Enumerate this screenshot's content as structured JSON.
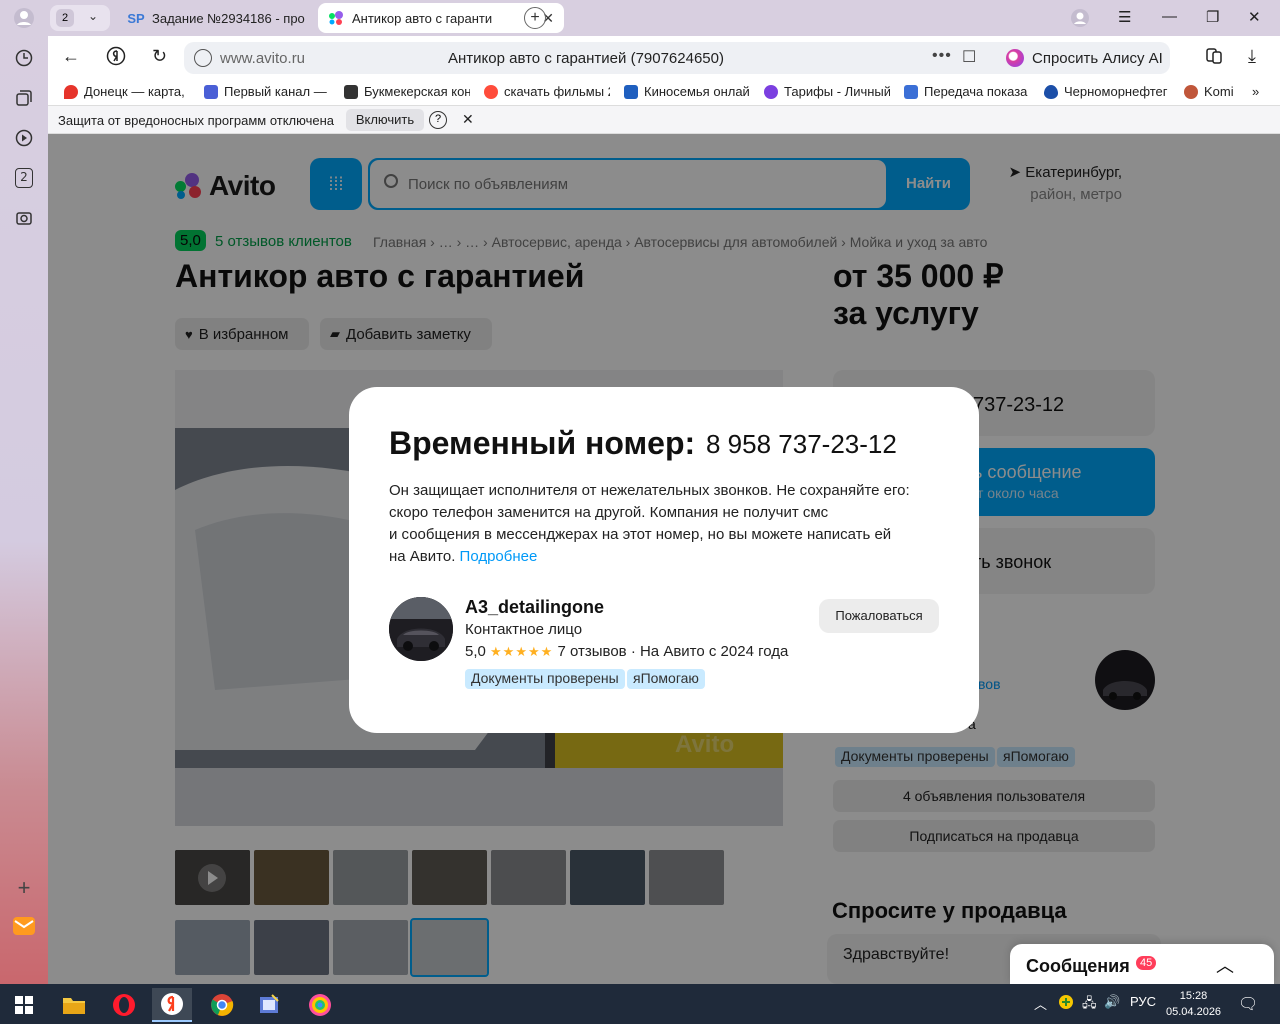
{
  "tabs": {
    "count": "2",
    "inactive_title": "Задание №2934186 - про",
    "active_title": "Антикор авто с гаранти",
    "inactive_favicon": "SP"
  },
  "address": {
    "domain": "www.avito.ru",
    "page_title": "Антикор авто с гарантией (7907624650)",
    "alice_label": "Спросить Алису AI"
  },
  "bookmarks": [
    {
      "label": "Донецк — карта, с",
      "color": "#e6342b"
    },
    {
      "label": "Первый канал — о",
      "color": "#4a5fd6"
    },
    {
      "label": "Букмекерская кон",
      "color": "#333333"
    },
    {
      "label": "скачать фильмы 2",
      "color": "#ff4c3b"
    },
    {
      "label": "Киносемья онлай",
      "color": "#1f5fbf"
    },
    {
      "label": "Тарифы - Личный",
      "color": "#7b3fe0"
    },
    {
      "label": "Передача показа",
      "color": "#3b6fd6"
    },
    {
      "label": "Черноморнефтег",
      "color": "#1c4fa8"
    },
    {
      "label": "Komi",
      "color": "#c0563a"
    }
  ],
  "infobar": {
    "message": "Защита от вредоносных программ отключена",
    "enable_label": "Включить",
    "help": "?"
  },
  "avito": {
    "logo": "Avito",
    "search_placeholder": "Поиск по объявлениям",
    "search_button": "Найти",
    "location_city": "Екатеринбург,",
    "location_sub": "район, метро",
    "rating": "5,0",
    "reviews_link": "5 отзывов клиентов",
    "breadcrumbs": "Главная › … › … › Автосервис, аренда › Автосервисы для автомобилей › Мойка и уход за авто",
    "title": "Антикор авто с гарантией",
    "price_line1": "от 35 000 ₽",
    "price_line2": "за услугу",
    "favorite_label": "В избранном",
    "note_label": "Добавить заметку",
    "phone_partial": "737-23-12",
    "message_btn": "ь сообщение",
    "message_btn_sub": "т около часа",
    "call_btn": "ть звонок",
    "reviews_partial": "вов",
    "role_partial": "а",
    "tag_docs": "Документы проверены",
    "tag_help": "яПомогаю",
    "other_ads": "4 объявления пользователя",
    "subscribe": "Подписаться на продавца",
    "ask_title": "Спросите у продавца",
    "ask_greeting": "Здравствуйте!",
    "messages_label": "Сообщения",
    "messages_count": "45",
    "watermark": "Avito"
  },
  "modal": {
    "title": "Временный номер:",
    "phone": "8 958 737-23-12",
    "body_line1": "Он защищает исполнителя от нежелательных звонков. Не сохраняйте его:",
    "body_line2": "скоро телефон заменится на другой. Компания не получит смс",
    "body_line3": "и сообщения в мессенджерах на этот номер, но вы можете написать ей",
    "body_line4": "на Авито.",
    "more_link": "Подробнее",
    "seller_name": "A3_detailingone",
    "seller_role": "Контактное лицо",
    "rating_value": "5,0",
    "stars": "★★★★★",
    "reviews": "7 отзывов · На Авито с 2024 года",
    "tag_docs": "Документы проверены",
    "tag_help": "яПомогаю",
    "report_label": "Пожаловаться"
  },
  "taskbar": {
    "lang": "РУС",
    "time": "15:28",
    "date": "05.04.2026"
  }
}
